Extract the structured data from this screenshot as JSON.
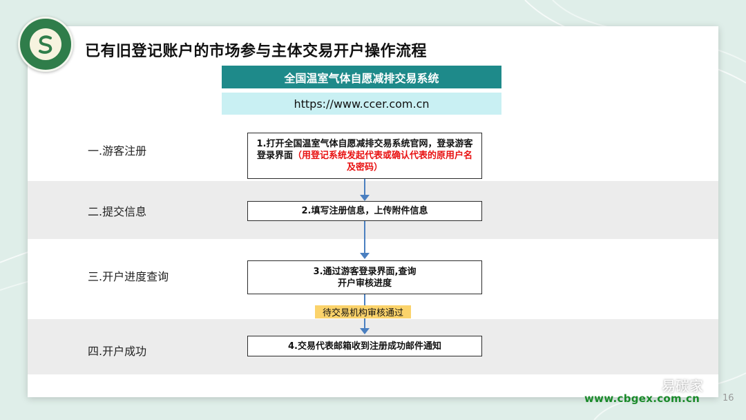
{
  "title": "已有旧登记账户的市场参与主体交易开户操作流程",
  "system": {
    "name": "全国温室气体自愿减排交易系统",
    "url": "https://www.ccer.com.cn"
  },
  "steps": [
    {
      "label": "一.游客注册",
      "text": "1.打开全国温室气体自愿减排交易系统官网，登录游客登录界面",
      "note": "（用登记系统发起代表或确认代表的原用户名及密码）"
    },
    {
      "label": "二.提交信息",
      "text": "2.填写注册信息，上传附件信息"
    },
    {
      "label": "三.开户进度查询",
      "text": "3.通过游客登录界面,查询开户审核进度"
    },
    {
      "label": "四.开户成功",
      "text": "4.交易代表邮箱收到注册成功邮件通知"
    }
  ],
  "badge": "待交易机构审核通过",
  "footer": {
    "wechat": "易碳家",
    "website": "www.cbgex.com.cn",
    "page": "16"
  },
  "colors": {
    "system_bar": "#1e8a8a",
    "url_bar": "#c9f0f3",
    "badge": "#fbd36b",
    "note_red": "#e81010",
    "website_green": "#1a8a2a",
    "arrow": "#4a7fc0"
  }
}
